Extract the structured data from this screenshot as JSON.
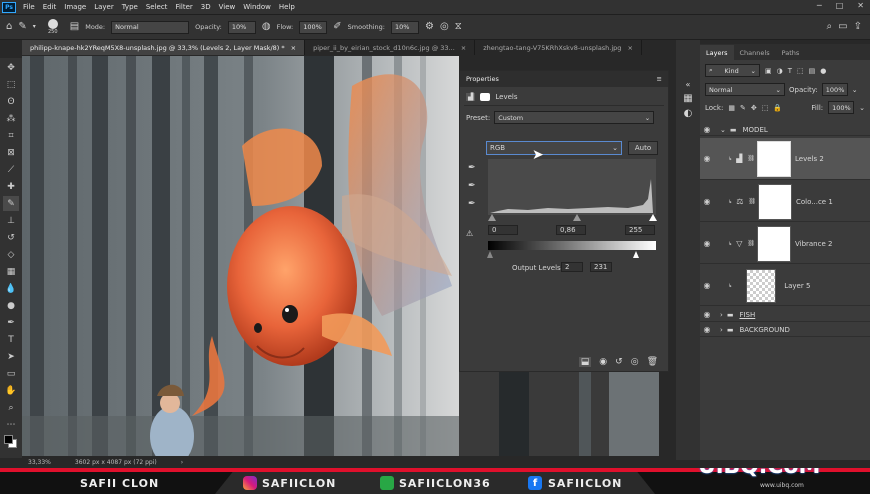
{
  "menu": [
    "File",
    "Edit",
    "Image",
    "Layer",
    "Type",
    "Select",
    "Filter",
    "3D",
    "View",
    "Window",
    "Help"
  ],
  "options": {
    "brush_size": "250",
    "mode_label": "Mode:",
    "mode": "Normal",
    "opacity_label": "Opacity:",
    "opacity": "10%",
    "flow_label": "Flow:",
    "flow": "100%",
    "smoothing_label": "Smoothing:",
    "smoothing": "10%"
  },
  "tabs": [
    "philipp-knape-hk2YReqM5X8-unsplash.jpg @ 33,3% (Levels 2, Layer Mask/8) *",
    "piper_ii_by_eirian_stock_d10n6c.jpg @ 33...",
    "zhengtao-tang-V75KRhXskv8-unsplash.jpg"
  ],
  "status": {
    "zoom": "33,33%",
    "dims": "3602 px x 4087 px (72 ppi)"
  },
  "properties": {
    "title": "Properties",
    "adj": "Levels",
    "preset_label": "Preset:",
    "preset": "Custom",
    "channel": "RGB",
    "auto": "Auto",
    "input_black": "0",
    "input_mid": "0,86",
    "input_white": "255",
    "output_label": "Output Levels:",
    "output_black": "2",
    "output_white": "231"
  },
  "layers": {
    "tabs": [
      "Layers",
      "Channels",
      "Paths"
    ],
    "kind": "Kind",
    "blend": "Normal",
    "opacity_label": "Opacity:",
    "opacity": "100%",
    "lock_label": "Lock:",
    "fill_label": "Fill:",
    "fill": "100%",
    "items": [
      "MODEL",
      "Levels 2",
      "Colo...ce 1",
      "Vibrance 2",
      "Layer 5",
      "FISH",
      "BACKGROUND"
    ]
  },
  "banner": {
    "left": "SAFII CLON",
    "ig": "SAFIICLON",
    "sc": "SAFIICLON36",
    "fb": "SAFIICLON",
    "logo": "UiBQ.CoM",
    "site": "www.uibq.com"
  },
  "colors": {
    "accent_red": "#e0102c",
    "panel": "#3b3b3b"
  }
}
